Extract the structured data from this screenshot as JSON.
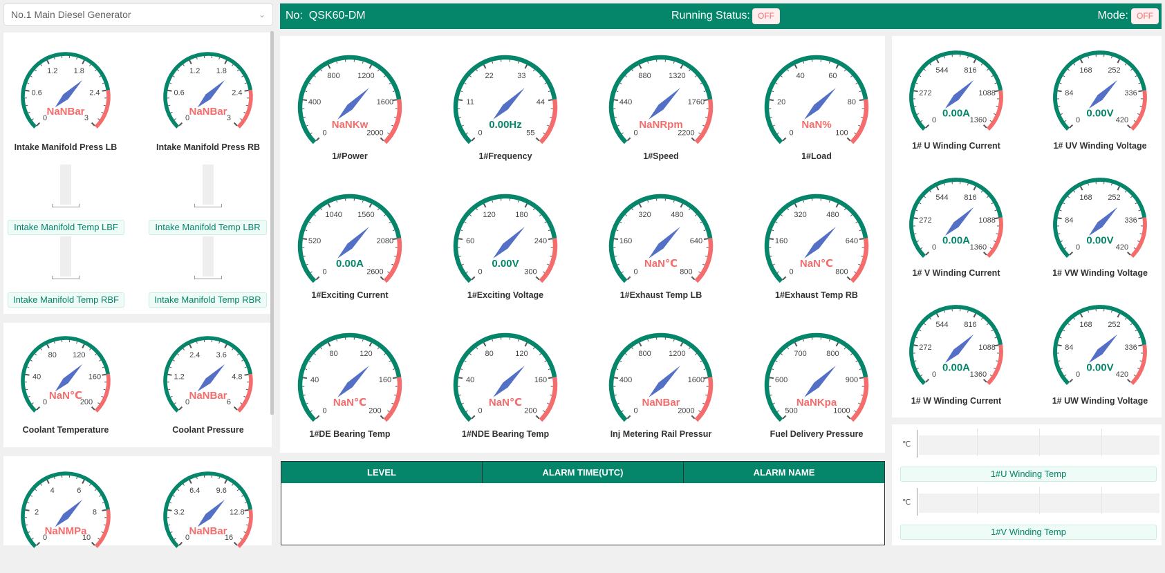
{
  "generator_select": {
    "value": "No.1 Main Diesel Generator"
  },
  "header": {
    "no_label": "No:",
    "model": "QSK60-DM",
    "running_status_label": "Running Status:",
    "running_status_value": "OFF",
    "mode_label": "Mode:",
    "mode_value": "OFF"
  },
  "colors": {
    "green": "#05856a",
    "red": "#f56c6c",
    "needle": "#5470c6"
  },
  "left_gauges": [
    {
      "label": "Intake Manifold Press LB",
      "ticks": [
        "0",
        "0.6",
        "1.2",
        "1.8",
        "2.4",
        "3"
      ],
      "value": "NaNBar",
      "value_color": "red"
    },
    {
      "label": "Intake Manifold Press RB",
      "ticks": [
        "0",
        "0.6",
        "1.2",
        "1.8",
        "2.4",
        "3"
      ],
      "value": "NaNBar",
      "value_color": "red"
    },
    {
      "label": "Coolant Temperature",
      "ticks": [
        "0",
        "40",
        "80",
        "120",
        "160",
        "200"
      ],
      "value": "NaN℃",
      "value_color": "red"
    },
    {
      "label": "Coolant Pressure",
      "ticks": [
        "0",
        "1.2",
        "2.4",
        "3.6",
        "4.8",
        "6"
      ],
      "value": "NaNBar",
      "value_color": "red"
    },
    {
      "label": "",
      "ticks": [
        "0",
        "2",
        "4",
        "6",
        "8",
        "10"
      ],
      "value": "NaNMPa",
      "value_color": "red"
    },
    {
      "label": "",
      "ticks": [
        "0",
        "3.2",
        "6.4",
        "9.6",
        "12.8",
        "16"
      ],
      "value": "NaNBar",
      "value_color": "red"
    }
  ],
  "temp_tags": [
    "Intake Manifold Temp LBF",
    "Intake Manifold Temp LBR",
    "Intake Manifold Temp RBF",
    "Intake Manifold Temp RBR"
  ],
  "center_gauges": [
    {
      "label": "1#Power",
      "ticks": [
        "0",
        "400",
        "800",
        "1200",
        "1600",
        "2000"
      ],
      "value": "NaNKw",
      "value_color": "red"
    },
    {
      "label": "1#Frequency",
      "ticks": [
        "0",
        "11",
        "22",
        "33",
        "44",
        "55"
      ],
      "value": "0.00Hz",
      "value_color": "green"
    },
    {
      "label": "1#Speed",
      "ticks": [
        "0",
        "440",
        "880",
        "1320",
        "1760",
        "2200"
      ],
      "value": "NaNRpm",
      "value_color": "red"
    },
    {
      "label": "1#Load",
      "ticks": [
        "0",
        "20",
        "40",
        "60",
        "80",
        "100"
      ],
      "value": "NaN%",
      "value_color": "red"
    },
    {
      "label": "1#Exciting Current",
      "ticks": [
        "0",
        "520",
        "1040",
        "1560",
        "2080",
        "2600"
      ],
      "value": "0.00A",
      "value_color": "green"
    },
    {
      "label": "1#Exciting Voltage",
      "ticks": [
        "0",
        "60",
        "120",
        "180",
        "240",
        "300"
      ],
      "value": "0.00V",
      "value_color": "green"
    },
    {
      "label": "1#Exhaust Temp LB",
      "ticks": [
        "0",
        "160",
        "320",
        "480",
        "640",
        "800"
      ],
      "value": "NaN℃",
      "value_color": "red"
    },
    {
      "label": "1#Exhaust Temp RB",
      "ticks": [
        "0",
        "160",
        "320",
        "480",
        "640",
        "800"
      ],
      "value": "NaN℃",
      "value_color": "red"
    },
    {
      "label": "1#DE Bearing Temp",
      "ticks": [
        "0",
        "40",
        "80",
        "120",
        "160",
        "200"
      ],
      "value": "NaN℃",
      "value_color": "red"
    },
    {
      "label": "1#NDE Bearing Temp",
      "ticks": [
        "0",
        "40",
        "80",
        "120",
        "160",
        "200"
      ],
      "value": "NaN℃",
      "value_color": "red"
    },
    {
      "label": "Inj Metering Rail Pressur",
      "ticks": [
        "0",
        "400",
        "800",
        "1200",
        "1600",
        "2000"
      ],
      "value": "NaNBar",
      "value_color": "red"
    },
    {
      "label": "Fuel Delivery Pressure",
      "ticks": [
        "500",
        "600",
        "700",
        "800",
        "900",
        "1000"
      ],
      "value": "NaNKpa",
      "value_color": "red"
    }
  ],
  "right_gauges": [
    {
      "label": "1# U Winding Current",
      "ticks": [
        "0",
        "272",
        "544",
        "816",
        "1088",
        "1360"
      ],
      "value": "0.00A",
      "value_color": "green"
    },
    {
      "label": "1# UV Winding Voltage",
      "ticks": [
        "0",
        "84",
        "168",
        "252",
        "336",
        "420"
      ],
      "value": "0.00V",
      "value_color": "green"
    },
    {
      "label": "1# V Winding Current",
      "ticks": [
        "0",
        "272",
        "544",
        "816",
        "1088",
        "1360"
      ],
      "value": "0.00A",
      "value_color": "green"
    },
    {
      "label": "1# VW Winding Voltage",
      "ticks": [
        "0",
        "84",
        "168",
        "252",
        "336",
        "420"
      ],
      "value": "0.00V",
      "value_color": "green"
    },
    {
      "label": "1# W Winding Current",
      "ticks": [
        "0",
        "272",
        "544",
        "816",
        "1088",
        "1360"
      ],
      "value": "0.00A",
      "value_color": "green"
    },
    {
      "label": "1# UW Winding Voltage",
      "ticks": [
        "0",
        "84",
        "168",
        "252",
        "336",
        "420"
      ],
      "value": "0.00V",
      "value_color": "green"
    }
  ],
  "alarm_table": {
    "columns": [
      "LEVEL",
      "ALARM TIME(UTC)",
      "ALARM NAME"
    ],
    "rows": []
  },
  "winding_temps": [
    {
      "unit": "℃",
      "label": "1#U Winding Temp"
    },
    {
      "unit": "℃",
      "label": "1#V Winding Temp"
    }
  ]
}
